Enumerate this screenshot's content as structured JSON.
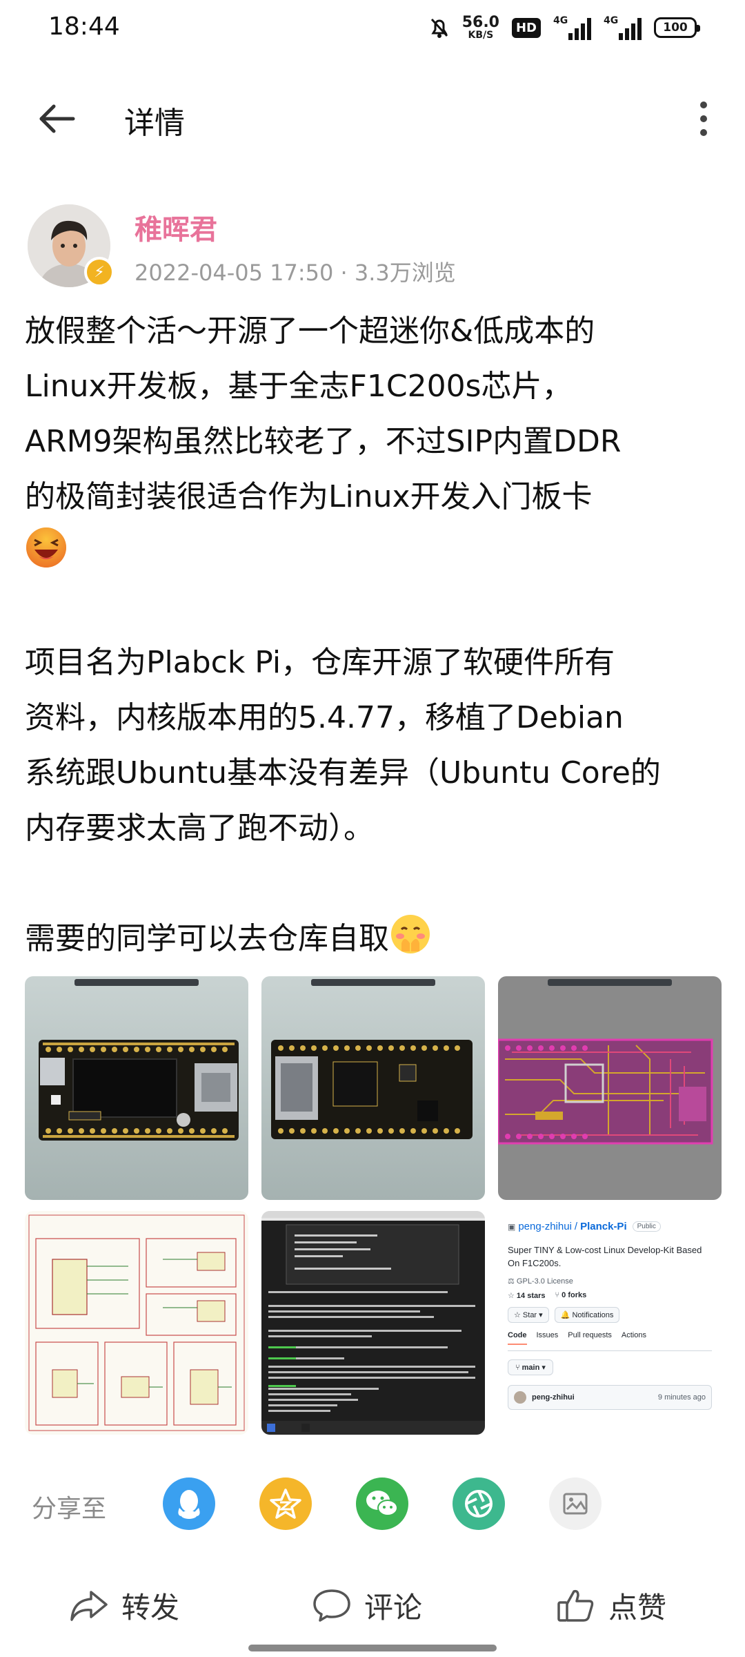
{
  "status_bar": {
    "time": "18:44",
    "net_speed": "56.0",
    "net_unit": "KB/S",
    "hd_label": "HD",
    "signal_1": "4G",
    "signal_2": "4G",
    "battery": "100"
  },
  "header": {
    "title": "详情"
  },
  "author": {
    "name": "稚晖君",
    "meta": "2022-04-05 17:50 · 3.3万浏览"
  },
  "post": {
    "p1_lines": [
      "放假整个活～开源了一个超迷你&低成本的",
      "Linux开发板，基于全志F1C200s芯片，",
      "ARM9架构虽然比较老了，不过SIP内置DDR",
      "的极简封装很适合作为Linux开发入门板卡"
    ],
    "p2_lines": [
      "项目名为Plabck Pi，仓库开源了软硬件所有",
      "资料，内核版本用的5.4.77，移植了Debian",
      "系统跟Ubuntu基本没有差异（Ubuntu Core的",
      "内存要求太高了跑不动）。"
    ],
    "p3": "需要的同学可以去仓库自取"
  },
  "github_thumb": {
    "owner": "peng-zhihui",
    "repo": "Planck-Pi",
    "visibility": "Public",
    "description": "Super TINY & Low-cost Linux Develop-Kit Based On F1C200s.",
    "license": "GPL-3.0 License",
    "stars": "14 stars",
    "forks": "0 forks",
    "star_btn": "Star",
    "notif_btn": "Notifications",
    "tabs": [
      "Code",
      "Issues",
      "Pull requests",
      "Actions"
    ],
    "branch": "main",
    "commit_user": "peng-zhihui",
    "commit_time": "9 minutes ago"
  },
  "share": {
    "label": "分享至"
  },
  "actions": {
    "forward": "转发",
    "comment": "评论",
    "like": "点赞"
  },
  "colors": {
    "author_name": "#e8739a",
    "qq": "#3aa0f0",
    "qzone": "#f5b62a",
    "wechat": "#3bb552",
    "moments": "#3db88e"
  }
}
